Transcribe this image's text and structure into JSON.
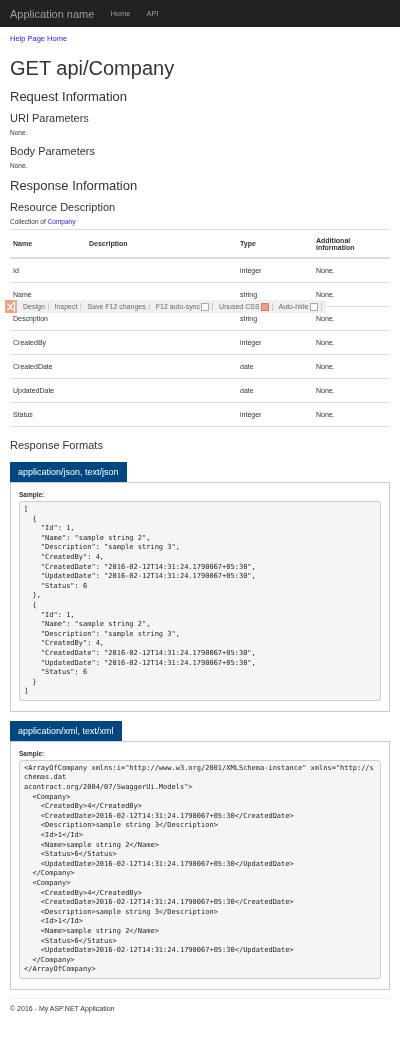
{
  "navbar": {
    "brand": "Application name",
    "links": [
      {
        "label": "Home"
      },
      {
        "label": "API"
      }
    ]
  },
  "breadcrumb": "Help Page Home",
  "title": "GET api/Company",
  "request": {
    "heading": "Request Information",
    "uri_heading": "URI Parameters",
    "uri_text": "None.",
    "body_heading": "Body Parameters",
    "body_text": "None."
  },
  "response": {
    "heading": "Response Information",
    "resource_heading": "Resource Description",
    "collection_prefix": "Collection of",
    "collection_link": "Company"
  },
  "table": {
    "columns": [
      "Name",
      "Description",
      "Type",
      "Additional information"
    ],
    "rows": [
      {
        "name": "Id",
        "description": "",
        "type": "integer",
        "info": "None."
      },
      {
        "name": "Name",
        "description": "",
        "type": "string",
        "info": "None."
      },
      {
        "name": "Description",
        "description": "",
        "type": "string",
        "info": "None."
      },
      {
        "name": "CreatedBy",
        "description": "",
        "type": "integer",
        "info": "None."
      },
      {
        "name": "CreatedDate",
        "description": "",
        "type": "date",
        "info": "None."
      },
      {
        "name": "UpdatedDate",
        "description": "",
        "type": "date",
        "info": "None."
      },
      {
        "name": "Status",
        "description": "",
        "type": "integer",
        "info": "None."
      }
    ]
  },
  "toolbar": {
    "items": [
      {
        "kind": "button",
        "label": "Design"
      },
      {
        "kind": "button",
        "label": "Inspect"
      },
      {
        "kind": "button",
        "label": "Save F12 changes"
      },
      {
        "kind": "checkbox",
        "label": "F12 auto-sync",
        "checked": false
      },
      {
        "kind": "checkbox",
        "label": "Unused CSS",
        "checked": true
      },
      {
        "kind": "checkbox",
        "label": "Auto-hide",
        "checked": false
      }
    ]
  },
  "formats_heading": "Response Formats",
  "formats": [
    {
      "tab": "application/json, text/json",
      "sample_label": "Sample:",
      "lines": [
        "[",
        "  {",
        "    \"Id\": 1,",
        "    \"Name\": \"sample string 2\",",
        "    \"Description\": \"sample string 3\",",
        "    \"CreatedBy\": 4,",
        "    \"CreatedDate\": \"2016-02-12T14:31:24.1790067+05:30\",",
        "    \"UpdatedDate\": \"2016-02-12T14:31:24.1790067+05:30\",",
        "    \"Status\": 6",
        "  },",
        "  {",
        "    \"Id\": 1,",
        "    \"Name\": \"sample string 2\",",
        "    \"Description\": \"sample string 3\",",
        "    \"CreatedBy\": 4,",
        "    \"CreatedDate\": \"2016-02-12T14:31:24.1790067+05:30\",",
        "    \"UpdatedDate\": \"2016-02-12T14:31:24.1790067+05:30\",",
        "    \"Status\": 6",
        "  }",
        "]"
      ]
    },
    {
      "tab": "application/xml, text/xml",
      "sample_label": "Sample:",
      "lines": [
        "<ArrayOfCompany xmlns:i=\"http://www.w3.org/2001/XMLSchema-instance\" xmlns=\"http://schemas.dat",
        "acontract.org/2004/07/SwaggerUi.Models\">",
        "  <Company>",
        "    <CreatedBy>4</CreatedBy>",
        "    <CreatedDate>2016-02-12T14:31:24.1790067+05:30</CreatedDate>",
        "    <Description>sample string 3</Description>",
        "    <Id>1</Id>",
        "    <Name>sample string 2</Name>",
        "    <Status>6</Status>",
        "    <UpdatedDate>2016-02-12T14:31:24.1790067+05:30</UpdatedDate>",
        "  </Company>",
        "  <Company>",
        "    <CreatedBy>4</CreatedBy>",
        "    <CreatedDate>2016-02-12T14:31:24.1790067+05:30</CreatedDate>",
        "    <Description>sample string 3</Description>",
        "    <Id>1</Id>",
        "    <Name>sample string 2</Name>",
        "    <Status>6</Status>",
        "    <UpdatedDate>2016-02-12T14:31:24.1790067+05:30</UpdatedDate>",
        "  </Company>",
        "</ArrayOfCompany>"
      ]
    }
  ],
  "footer": "© 2016 - My ASP.NET Application"
}
